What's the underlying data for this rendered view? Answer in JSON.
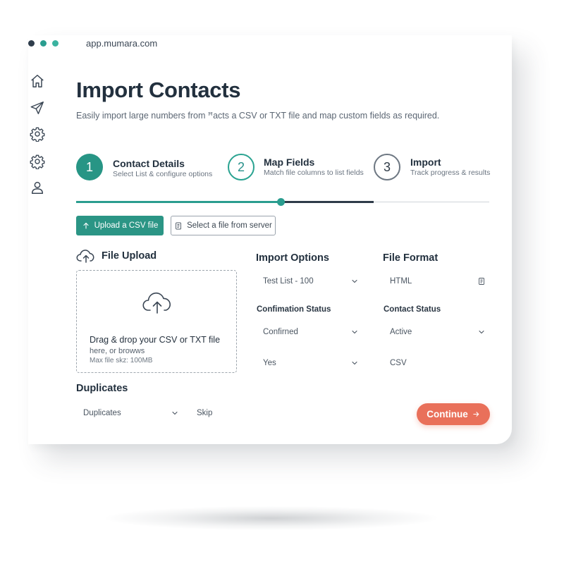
{
  "browser": {
    "url": "app.mumara.com"
  },
  "sidebar": {
    "items": [
      {
        "icon": "home-icon"
      },
      {
        "icon": "send-icon"
      },
      {
        "icon": "settings-icon"
      },
      {
        "icon": "settings-icon"
      },
      {
        "icon": "user-icon"
      }
    ]
  },
  "page": {
    "title": "Import Contacts",
    "subtitle": "Easily import large numbers from ꟸacts a CSV or TXT file and map custom fields as required."
  },
  "steps": [
    {
      "number": "1",
      "title": "Contact Details",
      "description": "Select List & configure options",
      "state": "active"
    },
    {
      "number": "2",
      "title": "Map Fields",
      "description": "Match file columns to list fields",
      "state": "current"
    },
    {
      "number": "3",
      "title": "Import",
      "description": "Track progress & results",
      "state": "pending"
    }
  ],
  "actions": {
    "upload_label": "Upload a CSV file",
    "select_label": "Select a file from server",
    "continue_label": "Continue"
  },
  "upload": {
    "heading": "File Upload",
    "drop_text": "Drag & drop your CSV or TXT file",
    "browse_text": "here, or browws",
    "max_size": "Max file skz: 100MB"
  },
  "import_options": {
    "heading": "Import Options",
    "list_value": "Test List - 100",
    "confirmation_label": "Confimation Status",
    "confirmation_value": "Confirned",
    "third_value": "Yes"
  },
  "file_format": {
    "heading": "File Format",
    "format_value": "HTML",
    "contact_status_label": "Contact Status",
    "contact_status_value": "Active",
    "third_value": "CSV"
  },
  "duplicates": {
    "heading": "Duplicates",
    "select_value": "Duplicates",
    "action_value": "Skip"
  },
  "colors": {
    "primary": "#2a9d8f",
    "accent": "#e9705a",
    "dark": "#22303e"
  }
}
